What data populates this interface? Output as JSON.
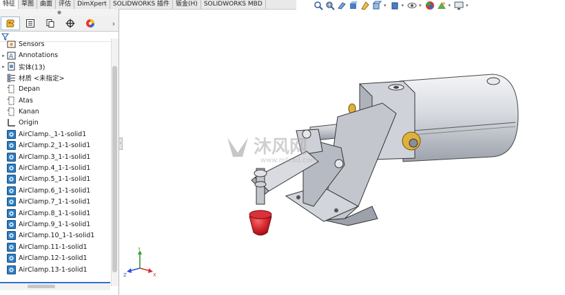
{
  "command_tabs": [
    "特征",
    "草图",
    "曲面",
    "评估",
    "DimXpert",
    "SOLIDWORKS 插件",
    "钣金(H)",
    "SOLIDWORKS MBD"
  ],
  "active_tab": "特征",
  "hud_icons": [
    "zoom-to-fit-icon",
    "zoom-to-area-icon",
    "previous-view-icon",
    "section-view-icon",
    "dynamic-annotation-icon",
    "view-orientation-icon",
    "display-style-icon",
    "hide-show-icon",
    "edit-appearance-icon",
    "apply-scene-icon",
    "view-settings-icon"
  ],
  "panel_tabs": [
    "featuremanager-icon",
    "propertymanager-icon",
    "configurationmanager-icon",
    "dimxpertmanager-icon",
    "displaymanager-icon"
  ],
  "tree": [
    {
      "label": "Sensors",
      "icon": "sensors-icon",
      "expandable": false
    },
    {
      "label": "Annotations",
      "icon": "annotations-icon",
      "expandable": true
    },
    {
      "label": "实体(13)",
      "icon": "solid-bodies-icon",
      "expandable": true
    },
    {
      "label": "材质 <未指定>",
      "icon": "material-icon",
      "expandable": false
    },
    {
      "label": "Depan",
      "icon": "plane-icon",
      "expandable": false
    },
    {
      "label": "Atas",
      "icon": "plane-icon",
      "expandable": false
    },
    {
      "label": "Kanan",
      "icon": "plane-icon",
      "expandable": false
    },
    {
      "label": "Origin",
      "icon": "origin-icon",
      "expandable": false
    },
    {
      "label": "AirClamp._1-1-solid1",
      "icon": "imported-feature-icon",
      "expandable": false
    },
    {
      "label": "AirClamp.2_1-1-solid1",
      "icon": "imported-feature-icon",
      "expandable": false
    },
    {
      "label": "AirClamp.3_1-1-solid1",
      "icon": "imported-feature-icon",
      "expandable": false
    },
    {
      "label": "AirClamp.4_1-1-solid1",
      "icon": "imported-feature-icon",
      "expandable": false
    },
    {
      "label": "AirClamp.5_1-1-solid1",
      "icon": "imported-feature-icon",
      "expandable": false
    },
    {
      "label": "AirClamp.6_1-1-solid1",
      "icon": "imported-feature-icon",
      "expandable": false
    },
    {
      "label": "AirClamp.7_1-1-solid1",
      "icon": "imported-feature-icon",
      "expandable": false
    },
    {
      "label": "AirClamp.8_1-1-solid1",
      "icon": "imported-feature-icon",
      "expandable": false
    },
    {
      "label": "AirClamp.9_1-1-solid1",
      "icon": "imported-feature-icon",
      "expandable": false
    },
    {
      "label": "AirClamp.10_1-1-solid1",
      "icon": "imported-feature-icon",
      "expandable": false
    },
    {
      "label": "AirClamp.11-1-solid1",
      "icon": "imported-feature-icon",
      "expandable": false
    },
    {
      "label": "AirClamp.12-1-solid1",
      "icon": "imported-feature-icon",
      "expandable": false
    },
    {
      "label": "AirClamp.13-1-solid1",
      "icon": "imported-feature-icon",
      "expandable": false
    }
  ],
  "watermark": {
    "main": "沐风网",
    "sub": "www.mfcad.com"
  },
  "triad": {
    "x": "X",
    "y": "Y",
    "z": "Z"
  },
  "colors": {
    "model_metal": "#c9ccd3",
    "clamp_tip": "#d3202a",
    "bushing": "#d9a21c",
    "accent": "#2f6fcf"
  }
}
